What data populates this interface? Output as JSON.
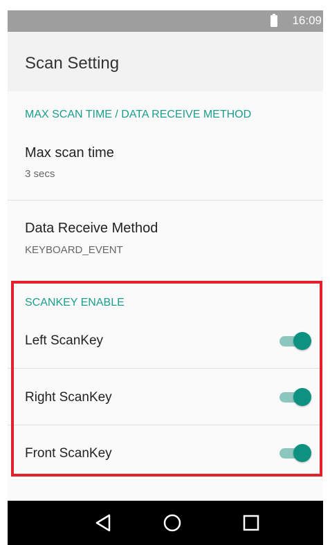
{
  "status_bar": {
    "time": "16:09",
    "battery_icon": "battery-icon"
  },
  "app_bar": {
    "title": "Scan Setting"
  },
  "sections": {
    "max_scan": {
      "header": "MAX SCAN TIME / DATA RECEIVE METHOD",
      "max_scan_time": {
        "title": "Max scan time",
        "summary": "3 secs"
      },
      "data_receive_method": {
        "title": "Data Receive Method",
        "summary": "KEYBOARD_EVENT"
      }
    },
    "scankey": {
      "header": "SCANKEY ENABLE",
      "left": {
        "label": "Left ScanKey",
        "enabled": true
      },
      "right": {
        "label": "Right ScanKey",
        "enabled": true
      },
      "front": {
        "label": "Front ScanKey",
        "enabled": true
      }
    }
  },
  "nav_bar": {
    "back_icon": "back-triangle-icon",
    "home_icon": "home-circle-icon",
    "recents_icon": "recents-square-icon"
  },
  "colors": {
    "accent": "#1a9e8c",
    "switch_thumb": "#0d9281",
    "switch_track": "#8cc7bf",
    "highlight": "#e4202a",
    "status_bar": "#9e9e9e"
  }
}
